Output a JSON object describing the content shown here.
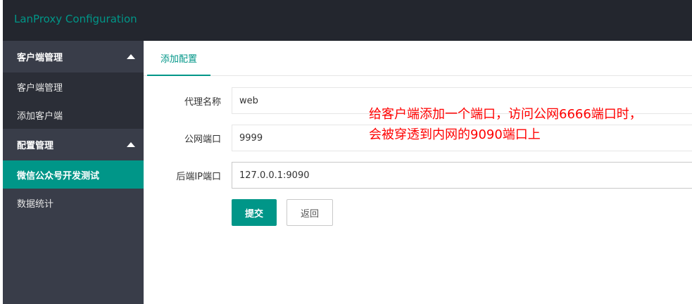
{
  "header": {
    "title": "LanProxy Configuration",
    "accent_color": "#009688"
  },
  "sidebar": {
    "groups": [
      {
        "label": "客户端管理",
        "items": [
          {
            "label": "客户端管理"
          },
          {
            "label": "添加客户端"
          }
        ]
      },
      {
        "label": "配置管理",
        "items": [
          {
            "label": "微信公众号开发测试",
            "active": true
          },
          {
            "label": "数据统计"
          }
        ]
      }
    ]
  },
  "main": {
    "tab": "添加配置",
    "form": {
      "fields": [
        {
          "label": "代理名称",
          "value": "web"
        },
        {
          "label": "公网端口",
          "value": "9999"
        },
        {
          "label": "后端IP端口",
          "value": "127.0.0.1:9090"
        }
      ],
      "submit_label": "提交",
      "back_label": "返回"
    }
  },
  "annotation": {
    "line1": "给客户端添加一个端口，访问公网6666端口时，",
    "line2": "会被穿透到内网的9090端口上",
    "color": "#ff0000"
  }
}
